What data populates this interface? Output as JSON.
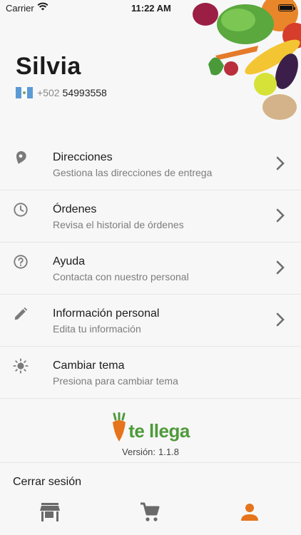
{
  "status_bar": {
    "carrier": "Carrier",
    "time": "11:22 AM"
  },
  "profile": {
    "name": "Silvia",
    "country_code": "+502",
    "phone": "54993558"
  },
  "menu": [
    {
      "icon": "location-pin-icon",
      "title": "Direcciones",
      "subtitle": "Gestiona las direcciones de entrega"
    },
    {
      "icon": "clock-icon",
      "title": "Órdenes",
      "subtitle": "Revisa el historial de órdenes"
    },
    {
      "icon": "help-circle-icon",
      "title": "Ayuda",
      "subtitle": "Contacta con nuestro personal"
    },
    {
      "icon": "pencil-icon",
      "title": "Información personal",
      "subtitle": "Edita tu información"
    },
    {
      "icon": "sun-icon",
      "title": "Cambiar tema",
      "subtitle": "Presiona para cambiar tema"
    }
  ],
  "brand": {
    "name": "te llega",
    "version_label": "Versión:",
    "version": "1.1.8"
  },
  "logout_label": "Cerrar sesión",
  "tabbar": [
    {
      "icon": "store-icon",
      "active": false
    },
    {
      "icon": "cart-icon",
      "active": false
    },
    {
      "icon": "person-icon",
      "active": true
    }
  ],
  "colors": {
    "accent": "#e5741c",
    "brand_green": "#4f9a3b",
    "icon_gray": "#7a7a7a"
  }
}
